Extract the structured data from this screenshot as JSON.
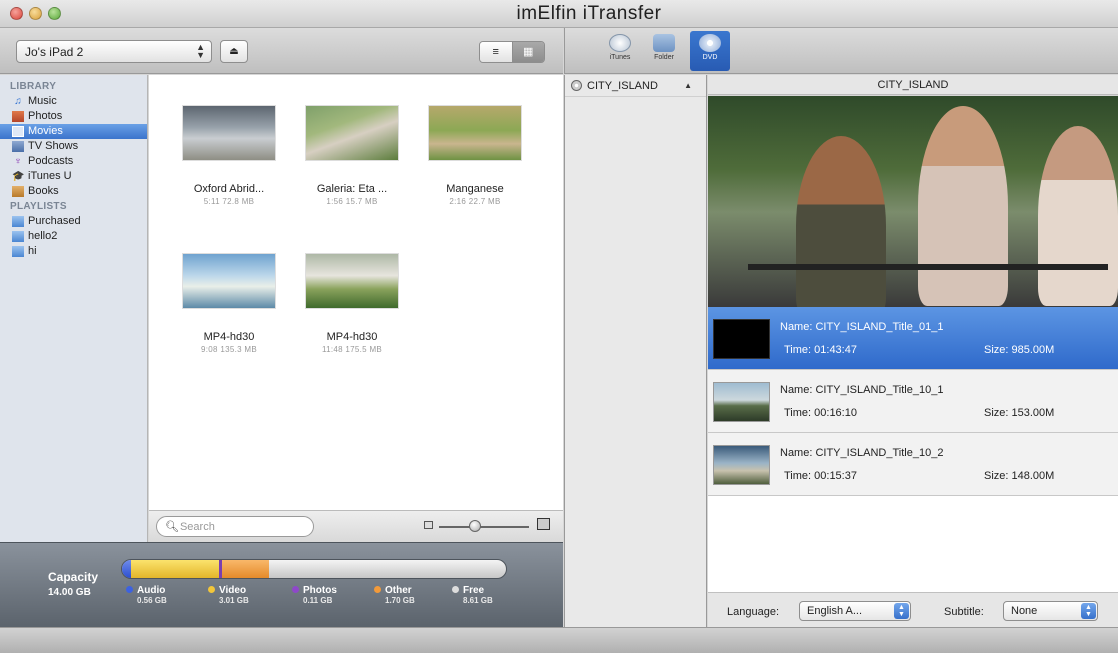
{
  "window": {
    "title": "imElfin  iTransfer"
  },
  "device": {
    "name": "Jo's iPad 2"
  },
  "sidebar": {
    "library_header": "LIBRARY",
    "library": [
      {
        "label": "Music",
        "icon": "music-icon",
        "color": "#2d6fd1"
      },
      {
        "label": "Photos",
        "icon": "photos-icon",
        "color": "#c9462a"
      },
      {
        "label": "Movies",
        "icon": "movies-icon",
        "color": "#ffffff",
        "selected": true
      },
      {
        "label": "TV Shows",
        "icon": "tv-icon",
        "color": "#4a6fa8"
      },
      {
        "label": "Podcasts",
        "icon": "podcast-icon",
        "color": "#8b3fb5"
      },
      {
        "label": "iTunes U",
        "icon": "itunes-u-icon",
        "color": "#333333"
      },
      {
        "label": "Books",
        "icon": "books-icon",
        "color": "#b87a2a"
      }
    ],
    "playlists_header": "PLAYLISTS",
    "playlists": [
      {
        "label": "Purchased",
        "icon": "playlist-icon"
      },
      {
        "label": "hello2",
        "icon": "playlist-icon"
      },
      {
        "label": "hi",
        "icon": "playlist-icon"
      }
    ]
  },
  "movies": [
    {
      "name": "Oxford Abrid...",
      "meta": "5:11  72.8 MB"
    },
    {
      "name": "Galeria: Eta ...",
      "meta": "1:56  15.7 MB"
    },
    {
      "name": "Manganese",
      "meta": "2:16  22.7 MB"
    },
    {
      "name": "MP4-hd30",
      "meta": "9:08  135.3 MB"
    },
    {
      "name": "MP4-hd30",
      "meta": "11:48  175.5 MB"
    }
  ],
  "search": {
    "placeholder": "Search"
  },
  "capacity": {
    "title": "Capacity",
    "total": "14.00 GB",
    "legend": [
      {
        "label": "Audio",
        "amount": "0.56 GB",
        "color": "#3d62e0"
      },
      {
        "label": "Video",
        "amount": "3.01 GB",
        "color": "#f2c63a"
      },
      {
        "label": "Photos",
        "amount": "0.11 GB",
        "color": "#8e48c9"
      },
      {
        "label": "Other",
        "amount": "1.70 GB",
        "color": "#f29a3a"
      },
      {
        "label": "Free",
        "amount": "8.61 GB",
        "color": "#dddddd"
      }
    ]
  },
  "toolbar": {
    "itunes": "iTunes",
    "folder": "Folder",
    "dvd": "DVD"
  },
  "dvd": {
    "disc": "CITY_ISLAND",
    "preview_title": "CITY_ISLAND",
    "titles": [
      {
        "name": "Name: CITY_ISLAND_Title_01_1",
        "time": "Time: 01:43:47",
        "size": "Size: 985.00M",
        "selected": true
      },
      {
        "name": "Name: CITY_ISLAND_Title_10_1",
        "time": "Time: 00:16:10",
        "size": "Size: 153.00M"
      },
      {
        "name": "Name: CITY_ISLAND_Title_10_2",
        "time": "Time: 00:15:37",
        "size": "Size: 148.00M"
      }
    ],
    "language_label": "Language:",
    "language_value": "English A...",
    "subtitle_label": "Subtitle:",
    "subtitle_value": "None"
  }
}
